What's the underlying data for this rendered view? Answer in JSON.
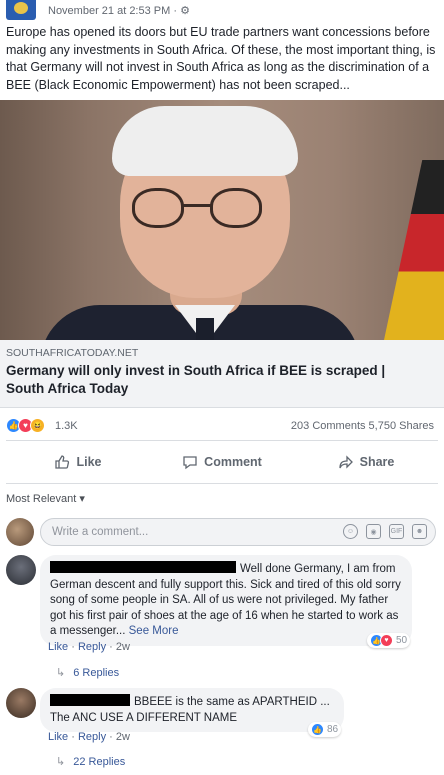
{
  "post": {
    "timestamp": "November 21 at 2:53 PM",
    "privacy_glyph": "· ⚙",
    "text": "Europe has opened its doors but EU trade partners want concessions before making any investments in South Africa. Of these, the most important thing, is that Germany will not invest in South Africa as long as the discrimination of a BEE (Black Economic Empowerment) has not been scraped..."
  },
  "link": {
    "domain": "SOUTHAFRICATODAY.NET",
    "title": "Germany will only invest in South Africa if BEE is scraped | South Africa Today"
  },
  "stats": {
    "reaction_count": "1.3K",
    "comments_shares": "203 Comments  5,750 Shares"
  },
  "actions": {
    "like": "Like",
    "comment": "Comment",
    "share": "Share"
  },
  "comments_section": {
    "sort_label": "Most Relevant ▾",
    "input_placeholder": "Write a comment...",
    "input_icons": [
      "emoji-icon",
      "camera-icon",
      "gif-icon",
      "sticker-icon"
    ]
  },
  "comments": [
    {
      "text": "Well done Germany, I am from German descent and fully support this. Sick and tired of this old sorry song of some people in SA. All of us were not privileged. My father got his first pair of shoes at the age of 16 when he started to work as a messenger...",
      "see_more": "See More",
      "reaction_count": "50",
      "like": "Like",
      "reply": "Reply",
      "age": "2w",
      "replies": "6 Replies"
    },
    {
      "text": "BBEEE is the same as APARTHEID ... The ANC USE A DIFFERENT NAME",
      "reaction_count": "86",
      "like": "Like",
      "reply": "Reply",
      "age": "2w",
      "replies": "22 Replies"
    }
  ],
  "colors": {
    "link_blue": "#385898",
    "like_blue": "#2d88ff",
    "love_red": "#f33e58",
    "haha_yellow": "#f7b125"
  }
}
